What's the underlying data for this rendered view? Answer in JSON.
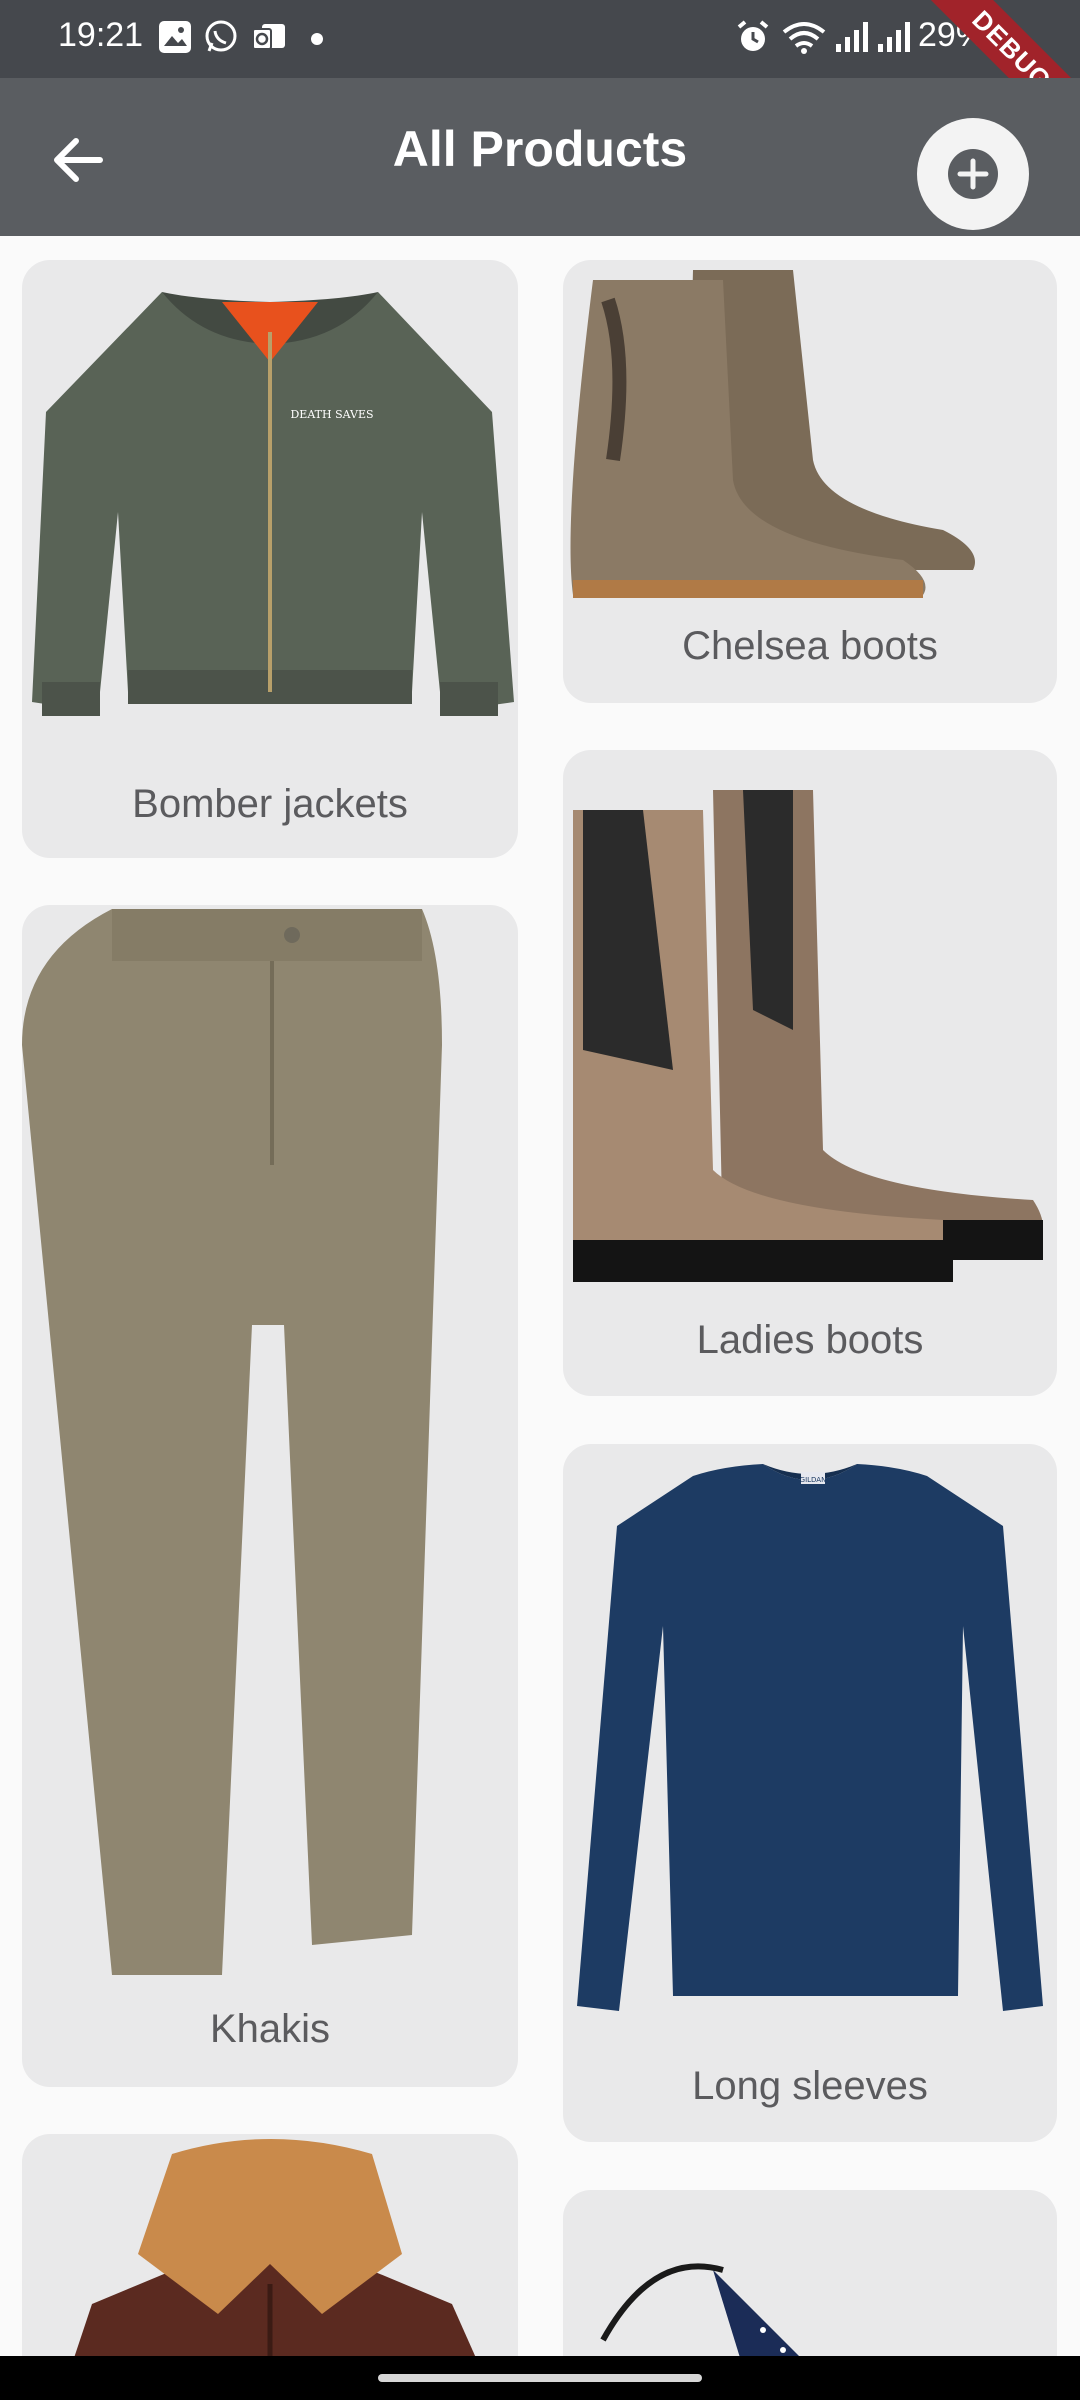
{
  "status_bar": {
    "time": "19:21",
    "battery": "29%"
  },
  "debug_banner": "DEBUG",
  "app_bar": {
    "title": "All Products"
  },
  "products": [
    {
      "name": "Bomber jackets",
      "print": "DEATH SAVES"
    },
    {
      "name": "Chelsea boots"
    },
    {
      "name": "Khakis"
    },
    {
      "name": "Ladies boots"
    },
    {
      "name": "Long sleeves",
      "tag": "GILDAN"
    },
    {
      "name": ""
    },
    {
      "name": ""
    }
  ],
  "icons": [
    "image-icon",
    "whatsapp-icon",
    "outlook-icon",
    "alarm-icon",
    "wifi-icon",
    "signal-icon",
    "back-arrow-icon",
    "add-circle-icon"
  ]
}
